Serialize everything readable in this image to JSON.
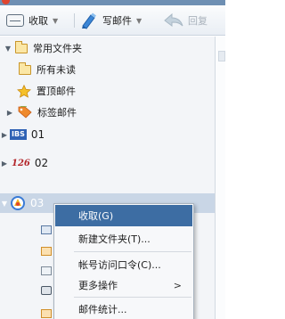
{
  "toolbar": {
    "receive_label": "收取",
    "compose_label": "写邮件",
    "reply_label": "回复",
    "icons": {
      "receive": "inbox-tray-icon",
      "compose": "pen-icon",
      "reply": "reply-arrow-icon"
    }
  },
  "tree": {
    "root_label": "常用文件夹",
    "items": [
      {
        "label": "所有未读",
        "icon": "folder-icon"
      },
      {
        "label": "置顶邮件",
        "icon": "star-icon"
      },
      {
        "label": "标签邮件",
        "icon": "tag-icon"
      }
    ],
    "accounts": [
      {
        "badge": "IBS",
        "label": "01"
      },
      {
        "badge": "126",
        "label": "02"
      },
      {
        "badge": "",
        "label": "03",
        "selected": true
      }
    ]
  },
  "context_menu": {
    "items": [
      {
        "label": "收取(G)",
        "highlighted": true
      },
      {
        "label": "新建文件夹(T)..."
      },
      {
        "label": "帐号访问口令(C)..."
      },
      {
        "label": "更多操作",
        "submenu_arrow": ">"
      },
      {
        "label": "邮件统计..."
      }
    ]
  },
  "colors": {
    "selection": "#c9d6e6",
    "menu_highlight": "#3d6da3",
    "folder_yellow": "#fbe7a6",
    "brand_126": "#b3262b",
    "brand_ibs": "#2f62b5"
  }
}
